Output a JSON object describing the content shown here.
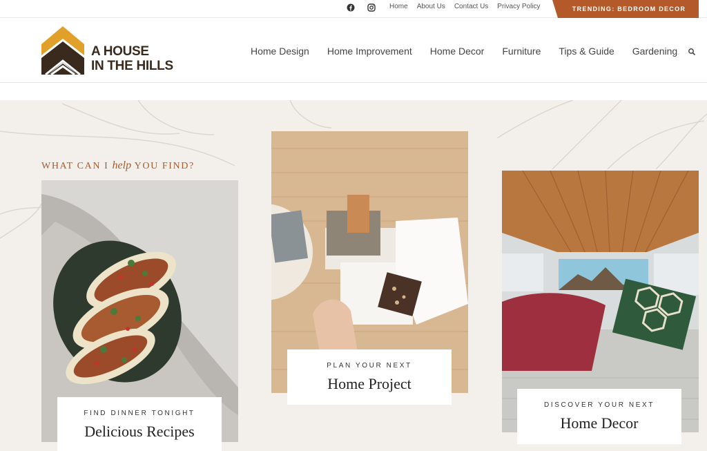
{
  "topbar": {
    "social": [
      {
        "icon": "facebook-icon"
      },
      {
        "icon": "instagram-icon"
      }
    ],
    "links": [
      "Home",
      "About Us",
      "Contact Us",
      "Privacy Policy"
    ],
    "trending": "TRENDING: BEDROOM DECOR"
  },
  "header": {
    "logo": {
      "line1": "A HOUSE",
      "line2": "IN THE HILLS"
    },
    "nav": [
      "Home Design",
      "Home Improvement",
      "Home Decor",
      "Furniture",
      "Tips & Guide",
      "Gardening"
    ],
    "search_icon": "search-icon"
  },
  "hero": {
    "eyebrow_pre": "WHAT CAN I ",
    "eyebrow_script": "help",
    "eyebrow_post": " YOU FIND?",
    "cards": [
      {
        "kicker": "FIND DINNER TONIGHT",
        "title": "Delicious Recipes",
        "image": "tacos-photo"
      },
      {
        "kicker": "PLAN YOUR NEXT",
        "title": "Home Project",
        "image": "material-samples-photo"
      },
      {
        "kicker": "DISCOVER YOUR NEXT",
        "title": "Home Decor",
        "image": "camper-van-bed-photo"
      }
    ]
  },
  "colors": {
    "accent": "#b45a2a",
    "hero_bg": "#f3f0ec",
    "logo_gold": "#e0a02a",
    "logo_dark": "#3a2a1e"
  }
}
